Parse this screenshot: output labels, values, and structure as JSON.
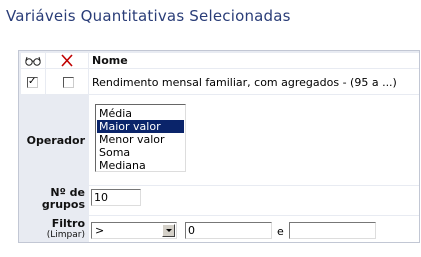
{
  "page": {
    "title": "Variáveis Quantitativas Selecionadas"
  },
  "table": {
    "header": {
      "view_icon": "glasses-icon",
      "remove_icon": "x-icon",
      "name_col": "Nome"
    },
    "rows": [
      {
        "view_checked": true,
        "remove_checked": false,
        "name": "Rendimento mensal familiar, com agregados - (95 a ...)"
      }
    ]
  },
  "operator": {
    "label": "Operador",
    "options": [
      "Média",
      "Maior valor",
      "Menor valor",
      "Soma",
      "Mediana"
    ],
    "selected": "Maior valor"
  },
  "groups": {
    "label_line1": "Nº de",
    "label_line2": "grupos",
    "value": "10"
  },
  "filter": {
    "label": "Filtro",
    "clear_link": "(Limpar)",
    "comparator": ">",
    "value_from": "0",
    "conjunction": "e",
    "value_to": ""
  },
  "colors": {
    "title": "#2a3d78",
    "panel_bg": "#e8ebf2",
    "selected_option": "#0a246a"
  }
}
